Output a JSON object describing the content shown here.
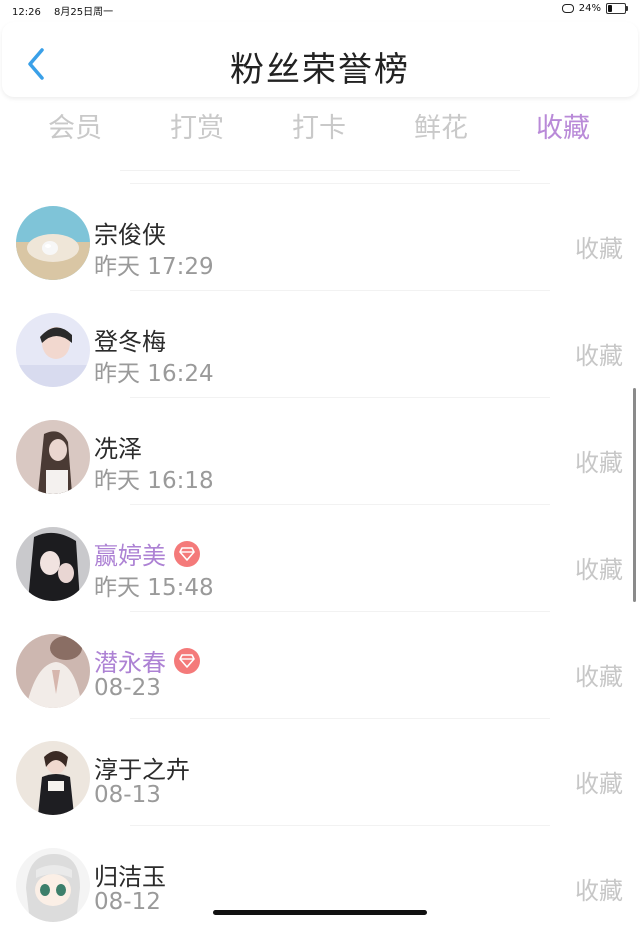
{
  "status": {
    "time": "12:26",
    "date": "8月25日周一",
    "battery": "24%",
    "battery_level": 0.24
  },
  "header": {
    "title": "粉丝荣誉榜"
  },
  "tabs": [
    {
      "label": "会员"
    },
    {
      "label": "打赏"
    },
    {
      "label": "打卡"
    },
    {
      "label": "鲜花"
    },
    {
      "label": "收藏",
      "active": true
    }
  ],
  "rows": [
    {
      "name": "宗俊侠",
      "time": "昨天 17:29",
      "action": "收藏",
      "vip": false
    },
    {
      "name": "登冬梅",
      "time": "昨天 16:24",
      "action": "收藏",
      "vip": false
    },
    {
      "name": "冼泽",
      "time": "昨天 16:18",
      "action": "收藏",
      "vip": false
    },
    {
      "name": "赢婷美",
      "time": "昨天 15:48",
      "action": "收藏",
      "vip": true
    },
    {
      "name": "潜永春",
      "time": "08-23",
      "action": "收藏",
      "vip": true
    },
    {
      "name": "淳于之卉",
      "time": "08-13",
      "action": "收藏",
      "vip": false
    },
    {
      "name": "归洁玉",
      "time": "08-12",
      "action": "收藏",
      "vip": false
    }
  ],
  "colors": {
    "accent": "#b98ad8",
    "vip_name": "#ad82d4",
    "badge": "#f47a7a",
    "back": "#3aa0e8"
  }
}
